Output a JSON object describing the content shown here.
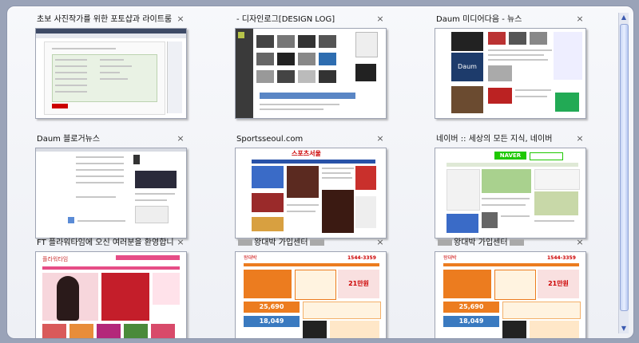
{
  "tiles": [
    {
      "title": "초보 사진작가를 위한 포토샵과 라이트룸 :: 글쓰기",
      "close": "×"
    },
    {
      "title": "- 디자인로그[DESIGN LOG]",
      "close": "×"
    },
    {
      "title": "Daum 미디어다음 - 뉴스",
      "close": "×"
    },
    {
      "title": "Daum 블로거뉴스",
      "close": "×"
    },
    {
      "title": "Sportsseoul.com",
      "close": "×"
    },
    {
      "title": "네이버 :: 세상의 모든 지식, 네이버",
      "close": "×"
    },
    {
      "title": "FT 플라워타임에 오신 여러분을 환영합니다.",
      "close": "×"
    },
    {
      "title": "왕대박 가입센터",
      "close": "×"
    },
    {
      "title": "왕대박 가입센터",
      "close": "×"
    }
  ],
  "thumb_text": {
    "daum_logo": "Daum",
    "sports_logo": "스포츠서울",
    "naver_logo": "NAVER",
    "wangdaebak_logo": "왕대박",
    "phone1": "1544-3359",
    "price1": "25,690",
    "price2": "18,049",
    "promo": "21만원",
    "flower_logo": "플라워타임"
  },
  "scrollbar": {
    "up": "▲",
    "down": "▼"
  }
}
